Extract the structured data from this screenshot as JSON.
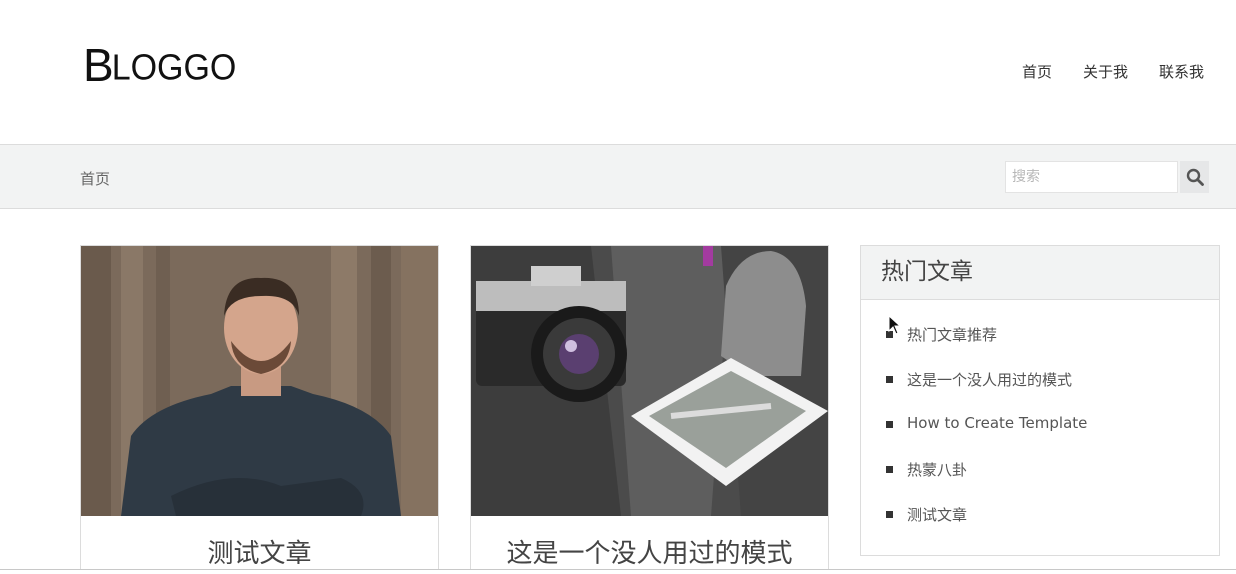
{
  "header": {
    "logo_initial": "B",
    "logo_rest": "LOGGO",
    "nav": [
      {
        "label": "首页"
      },
      {
        "label": "关于我"
      },
      {
        "label": "联系我"
      }
    ]
  },
  "subbar": {
    "breadcrumb": "首页",
    "search_placeholder": "搜索"
  },
  "posts": [
    {
      "title": "测试文章",
      "image": "portrait-man-photo"
    },
    {
      "title": "这是一个没人用过的模式",
      "image": "camera-photo"
    }
  ],
  "sidebar": {
    "widget_title": "热门文章",
    "items": [
      {
        "label": "热门文章推荐"
      },
      {
        "label": "这是一个没人用过的模式"
      },
      {
        "label": "How to Create Template"
      },
      {
        "label": "热蒙八卦"
      },
      {
        "label": "测试文章"
      }
    ]
  },
  "colors": {
    "subbar_bg": "#f2f3f3",
    "border": "#dcdcdc",
    "text": "#333333"
  }
}
